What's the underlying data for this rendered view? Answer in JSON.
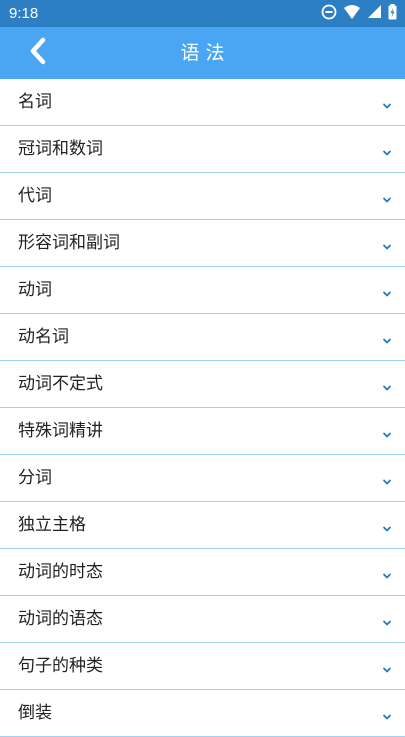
{
  "status_bar": {
    "time": "9:18",
    "icons": [
      "do-not-disturb-icon",
      "wifi-icon",
      "signal-icon",
      "battery-icon"
    ]
  },
  "header": {
    "title": "语法",
    "back_icon": "chevron-left-icon"
  },
  "colors": {
    "status_bar": "#2d7fc4",
    "app_bar": "#4aa6f2",
    "divider": "#9fd0f5",
    "chevron": "#2b78b8",
    "text": "#222222"
  },
  "list": {
    "expand_icon": "chevron-down-icon",
    "items": [
      {
        "label": "名词"
      },
      {
        "label": "冠词和数词"
      },
      {
        "label": "代词"
      },
      {
        "label": "形容词和副词"
      },
      {
        "label": "动词"
      },
      {
        "label": "动名词"
      },
      {
        "label": "动词不定式"
      },
      {
        "label": "特殊词精讲"
      },
      {
        "label": "分词"
      },
      {
        "label": "独立主格"
      },
      {
        "label": "动词的时态"
      },
      {
        "label": "动词的语态"
      },
      {
        "label": "句子的种类"
      },
      {
        "label": "倒装"
      }
    ]
  }
}
